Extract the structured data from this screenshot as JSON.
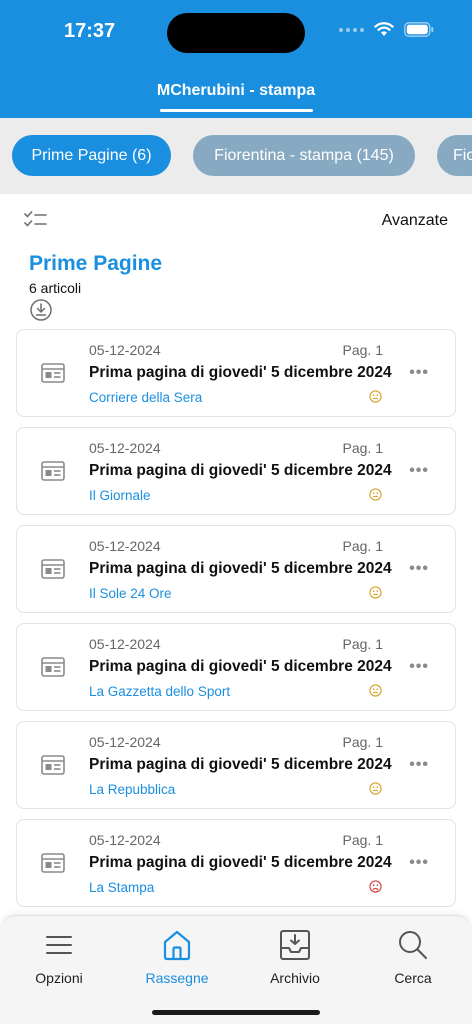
{
  "status_bar": {
    "time": "17:37"
  },
  "header": {
    "title": "MCherubini - stampa"
  },
  "chips": [
    {
      "label": "Prime Pagine (6)"
    },
    {
      "label": "Fiorentina - stampa (145)"
    },
    {
      "label": "Fio"
    }
  ],
  "toolbar": {
    "advanced_label": "Avanzate"
  },
  "section": {
    "title": "Prime Pagine",
    "count": "6 articoli"
  },
  "articles": [
    {
      "date": "05-12-2024",
      "page": "Pag. 1",
      "title": "Prima pagina di giovedi' 5 dicembre 2024",
      "source": "Corriere della Sera",
      "sentiment": "neutral",
      "sentiment_color": "#d7a12a"
    },
    {
      "date": "05-12-2024",
      "page": "Pag. 1",
      "title": "Prima pagina di giovedi' 5 dicembre 2024",
      "source": "Il Giornale",
      "sentiment": "neutral",
      "sentiment_color": "#d7a12a"
    },
    {
      "date": "05-12-2024",
      "page": "Pag. 1",
      "title": "Prima pagina di giovedi' 5 dicembre 2024",
      "source": "Il Sole 24 Ore",
      "sentiment": "neutral",
      "sentiment_color": "#d7a12a"
    },
    {
      "date": "05-12-2024",
      "page": "Pag. 1",
      "title": "Prima pagina di giovedi' 5 dicembre 2024",
      "source": "La Gazzetta dello Sport",
      "sentiment": "neutral",
      "sentiment_color": "#d7a12a"
    },
    {
      "date": "05-12-2024",
      "page": "Pag. 1",
      "title": "Prima pagina di giovedi' 5 dicembre 2024",
      "source": "La Repubblica",
      "sentiment": "neutral",
      "sentiment_color": "#d7a12a"
    },
    {
      "date": "05-12-2024",
      "page": "Pag. 1",
      "title": "Prima pagina di giovedi' 5 dicembre 2024",
      "source": "La Stampa",
      "sentiment": "negative",
      "sentiment_color": "#d93a3a"
    }
  ],
  "tabs": [
    {
      "label": "Opzioni",
      "icon": "menu-icon"
    },
    {
      "label": "Rassegne",
      "icon": "home-icon",
      "active": true
    },
    {
      "label": "Archivio",
      "icon": "archive-icon"
    },
    {
      "label": "Cerca",
      "icon": "search-icon"
    }
  ],
  "colors": {
    "accent": "#1a8fe0",
    "chip_inactive": "#87a9c2",
    "neutral_sentiment": "#d7a12a",
    "negative_sentiment": "#d93a3a"
  }
}
